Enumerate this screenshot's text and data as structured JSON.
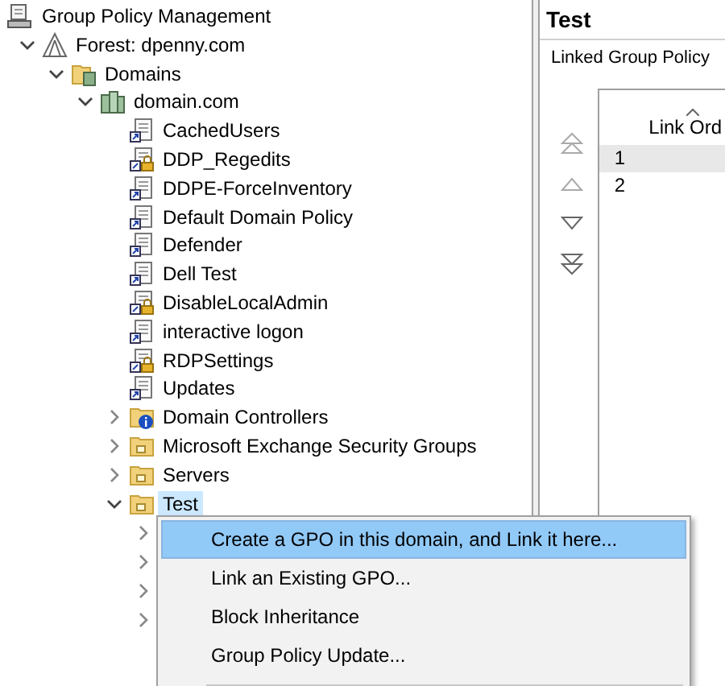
{
  "tree": {
    "label": "Group Policy Management",
    "children": [
      {
        "label": "Forest: dpenny.com",
        "kind": "forest",
        "expanded": true,
        "selected": false,
        "children": [
          {
            "label": "Domains",
            "kind": "domains",
            "expanded": true,
            "selected": false,
            "children": [
              {
                "label": "domain.com",
                "kind": "domain",
                "expanded": true,
                "selected": false,
                "children": [
                  {
                    "label": "CachedUsers",
                    "kind": "gpo",
                    "selected": false
                  },
                  {
                    "label": "DDP_Regedits",
                    "kind": "gpo-locked",
                    "selected": false
                  },
                  {
                    "label": "DDPE-ForceInventory",
                    "kind": "gpo",
                    "selected": false
                  },
                  {
                    "label": "Default Domain Policy",
                    "kind": "gpo",
                    "selected": false
                  },
                  {
                    "label": "Defender",
                    "kind": "gpo",
                    "selected": false
                  },
                  {
                    "label": "Dell Test",
                    "kind": "gpo",
                    "selected": false
                  },
                  {
                    "label": "DisableLocalAdmin",
                    "kind": "gpo-locked",
                    "selected": false
                  },
                  {
                    "label": "interactive logon",
                    "kind": "gpo",
                    "selected": false
                  },
                  {
                    "label": "RDPSettings",
                    "kind": "gpo-locked",
                    "selected": false
                  },
                  {
                    "label": "Updates",
                    "kind": "gpo",
                    "selected": false
                  },
                  {
                    "label": "Domain Controllers",
                    "kind": "ou-dc",
                    "expanded": false,
                    "selected": false
                  },
                  {
                    "label": "Microsoft Exchange Security Groups",
                    "kind": "ou",
                    "expanded": false,
                    "selected": false
                  },
                  {
                    "label": "Servers",
                    "kind": "ou",
                    "expanded": false,
                    "selected": false
                  },
                  {
                    "label": "Test",
                    "kind": "ou",
                    "expanded": true,
                    "selected": true
                  }
                ]
              }
            ]
          }
        ]
      }
    ]
  },
  "hidden_rows": [
    {
      "expanded": false
    },
    {
      "expanded": false
    },
    {
      "expanded": false
    },
    {
      "expanded": false
    }
  ],
  "details": {
    "title": "Test",
    "tab": "Linked Group Policy",
    "column": "Link Ord",
    "rows": [
      {
        "order": "1",
        "selected": true
      },
      {
        "order": "2",
        "selected": false
      }
    ]
  },
  "context_menu": [
    {
      "label": "Create a GPO in this domain, and Link it here...",
      "selected": true
    },
    {
      "label": "Link an Existing GPO...",
      "selected": false
    },
    {
      "label": "Block Inheritance",
      "selected": false
    },
    {
      "label": "Group Policy Update...",
      "selected": false
    }
  ]
}
